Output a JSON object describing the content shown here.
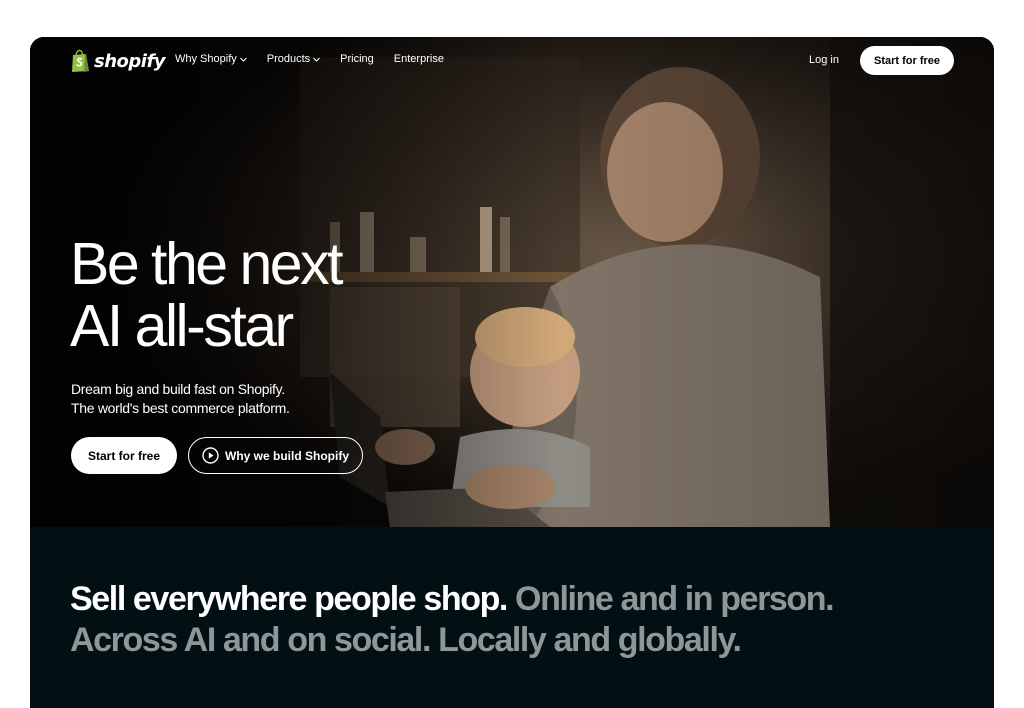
{
  "brand": {
    "name": "shopify",
    "logo_icon": "shopping-bag-icon",
    "color": "#95bf47"
  },
  "nav": {
    "links": [
      {
        "label": "Why Shopify",
        "has_dropdown": true
      },
      {
        "label": "Products",
        "has_dropdown": true
      },
      {
        "label": "Pricing",
        "has_dropdown": false
      },
      {
        "label": "Enterprise",
        "has_dropdown": false
      }
    ],
    "login_label": "Log in",
    "cta_label": "Start for free"
  },
  "hero": {
    "headline_line1": "Be the next",
    "headline_line2": "AI all-star",
    "sub_line1": "Dream big and build fast on Shopify.",
    "sub_line2": "The world's best commerce platform.",
    "primary_button": "Start for free",
    "secondary_button": "Why we build Shopify",
    "secondary_icon": "play-circle-icon"
  },
  "section": {
    "white_text": "Sell everywhere people shop.",
    "grey_text_1": "Online and in person.",
    "grey_text_2": "Across AI and on social. Locally and globally."
  },
  "colors": {
    "lower_bg": "#021013",
    "grey_text": "#8e9699",
    "hero_bg": "#0b0907"
  }
}
